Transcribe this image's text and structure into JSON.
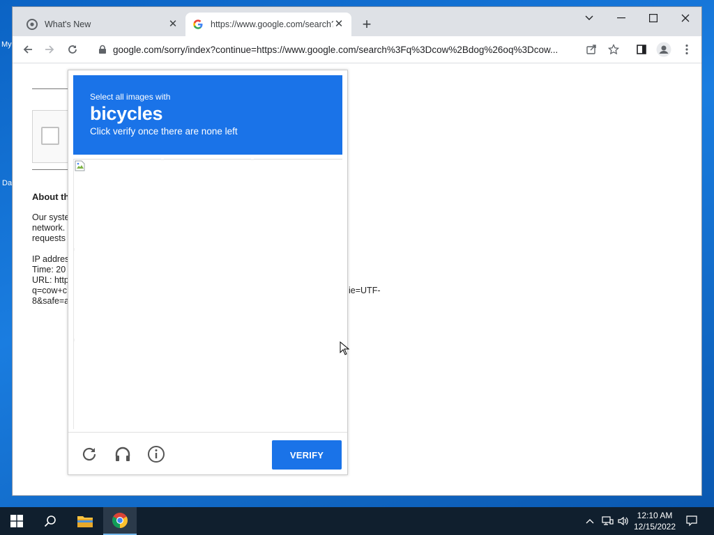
{
  "desktop": {
    "icon_labels": [
      "My",
      "Da"
    ]
  },
  "browser": {
    "tabs": [
      {
        "title": "What's New",
        "active": false
      },
      {
        "title": "https://www.google.com/search?",
        "active": true
      }
    ],
    "new_tab": "+",
    "address": "google.com/sorry/index?continue=https://www.google.com/search%3Fq%3Dcow%2Bdog%26oq%3Dcow..."
  },
  "page": {
    "about_heading": "About th",
    "body_lines": [
      "Our syste",
      "network.",
      "requests"
    ],
    "info_lines": [
      "IP addres",
      "Time: 20",
      "URL: http",
      "q=cow+c",
      "8&safe=a"
    ],
    "url_tail": "ie=UTF-"
  },
  "challenge": {
    "instruction_small": "Select all images with",
    "target": "bicycles",
    "instruction_sub": "Click verify once there are none left",
    "verify_label": "VERIFY",
    "accent": "#1a73e8"
  },
  "taskbar": {
    "time": "12:10 AM",
    "date": "12/15/2022"
  }
}
